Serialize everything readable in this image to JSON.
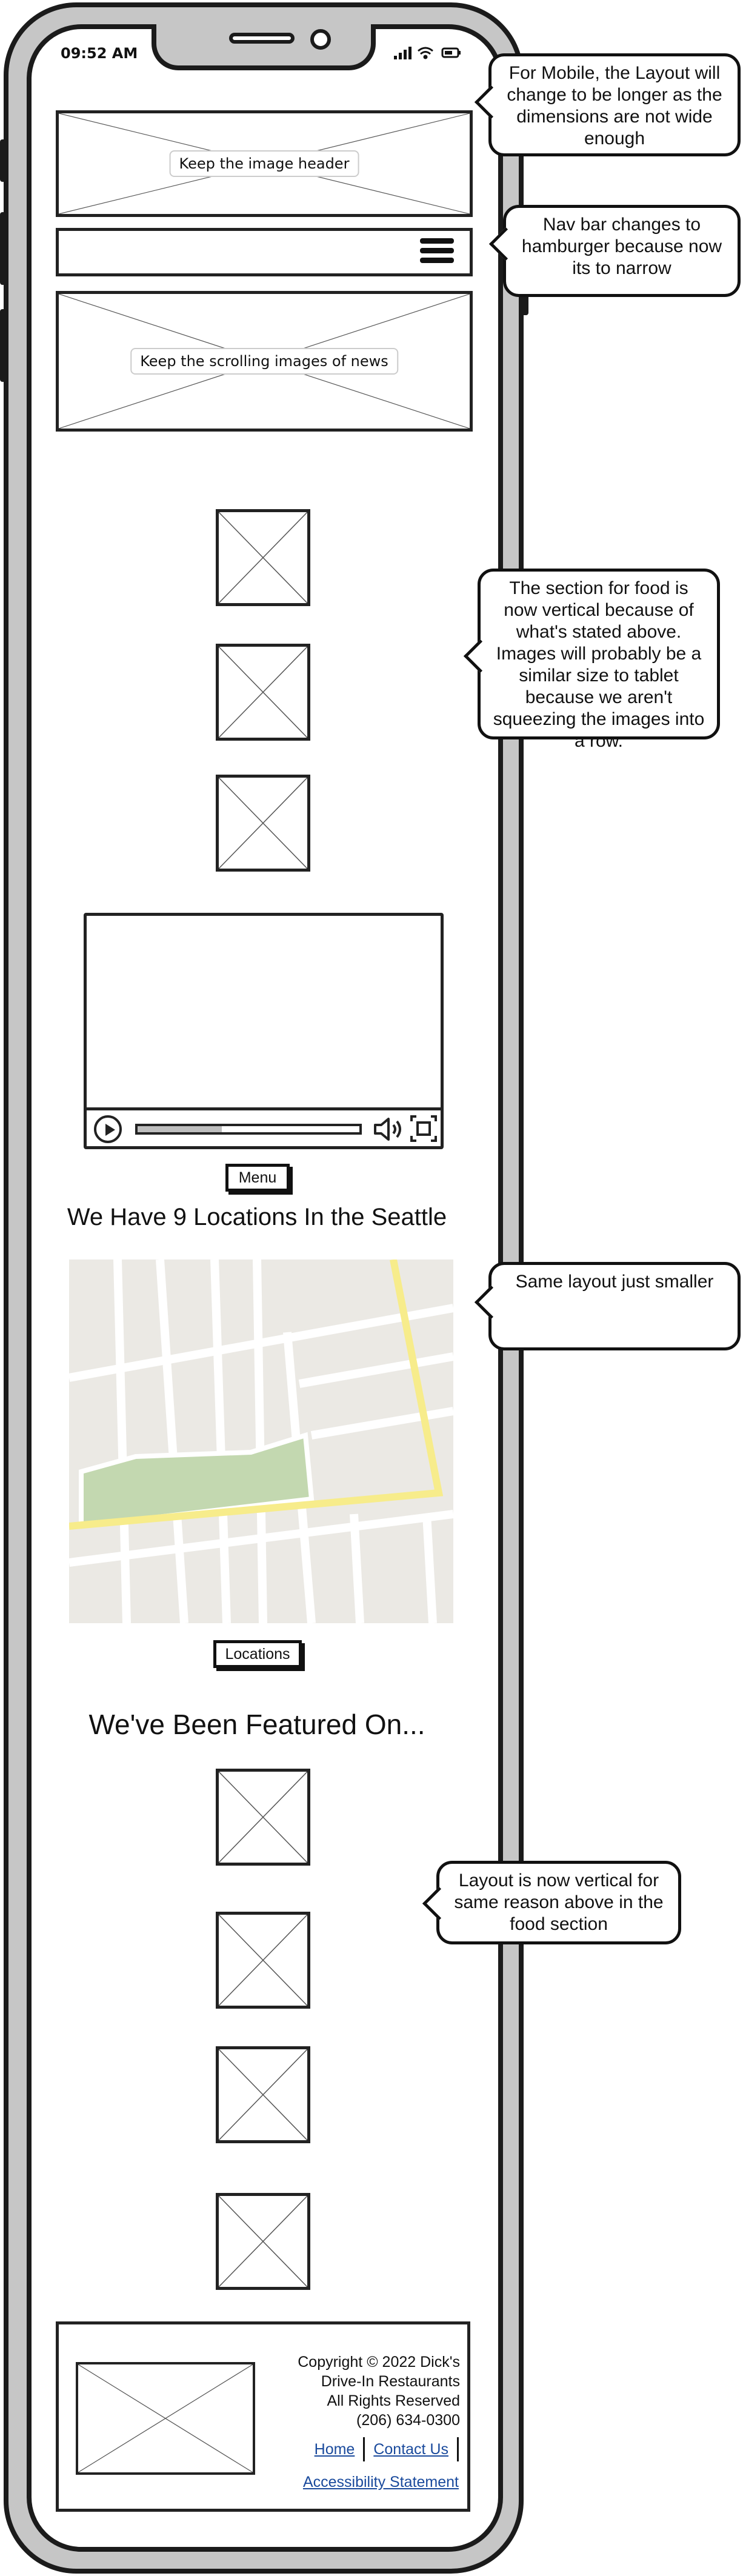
{
  "status_bar": {
    "time": "09:52 AM"
  },
  "header_image": {
    "label": "Keep the image header"
  },
  "nav": {
    "icon": "hamburger-menu-icon"
  },
  "news_image": {
    "label": "Keep the scrolling images of news"
  },
  "video": {
    "progress": 0.38
  },
  "menu_button": {
    "label": "Menu"
  },
  "locations": {
    "heading": "We Have 9 Locations In the Seattle",
    "button_label": "Locations"
  },
  "featured": {
    "heading": "We've Been Featured On..."
  },
  "footer": {
    "copyright_lines": [
      "Copyright © 2022 Dick's",
      "Drive-In Restaurants",
      "All Rights Reserved",
      "(206) 634-0300"
    ],
    "links": [
      "Home",
      "Contact Us"
    ],
    "accessibility_link": "Accessibility Statement"
  },
  "callouts": [
    "For Mobile, the Layout will change to be longer as the dimensions are not wide enough",
    "Nav bar changes to hamburger because now its to narrow",
    "The section for food is now vertical because of what's stated above. Images will probably be a similar size to tablet because we aren't squeezing the images into a row.",
    "Same layout just smaller",
    "Layout is now vertical for same reason above in the food section"
  ],
  "colors": {
    "map_road_major": "#f7ec8b",
    "map_park": "#c3d8b0",
    "map_bg": "#ebe9e4",
    "link": "#1a4a9c"
  }
}
